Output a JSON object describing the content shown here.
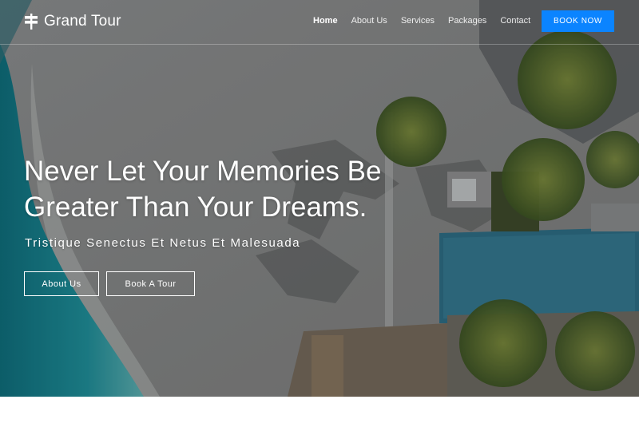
{
  "brand": {
    "name": "Grand Tour",
    "icon": "signpost-icon"
  },
  "nav": {
    "links": [
      {
        "label": "Home",
        "active": true
      },
      {
        "label": "About Us",
        "active": false
      },
      {
        "label": "Services",
        "active": false
      },
      {
        "label": "Packages",
        "active": false
      },
      {
        "label": "Contact",
        "active": false
      }
    ],
    "book_now": "BOOK NOW"
  },
  "hero": {
    "headline_line1": "Never Let Your Memories Be",
    "headline_line2": "Greater Than Your Dreams.",
    "subtitle": "Tristique Senectus Et Netus Et Malesuada",
    "buttons": {
      "about": "About Us",
      "tour": "Book A Tour"
    }
  },
  "colors": {
    "accent": "#0b84ff",
    "sea": "#1b8f9c",
    "sand": "#8c8c8a",
    "pool": "#2a6f86",
    "palm": "#5f7a32"
  }
}
